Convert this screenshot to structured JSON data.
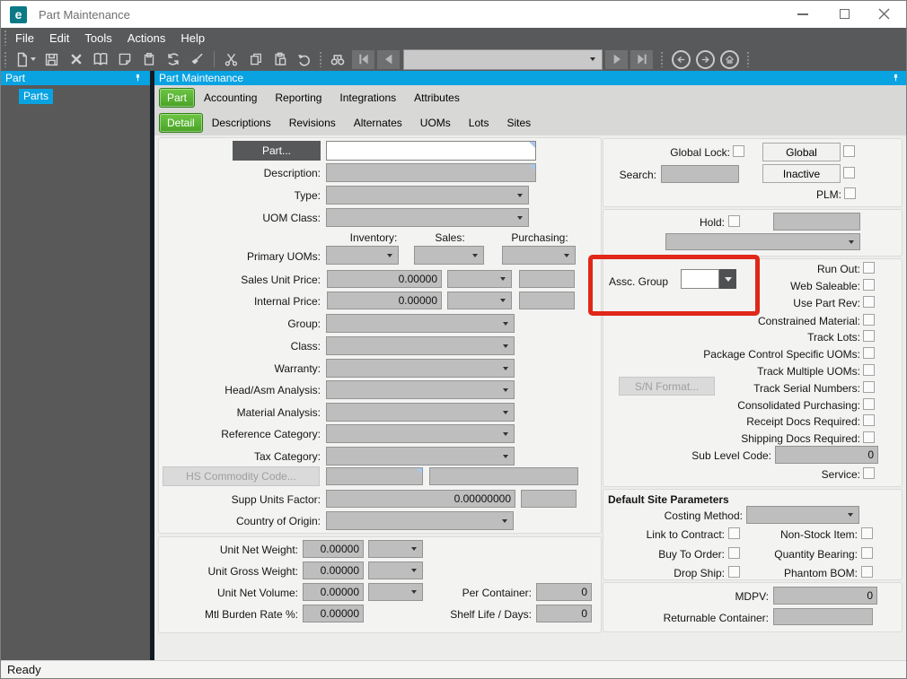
{
  "window": {
    "logo_text": "e",
    "title": "Part Maintenance",
    "status": "Ready"
  },
  "menu": {
    "items": [
      "File",
      "Edit",
      "Tools",
      "Actions",
      "Help"
    ]
  },
  "toolbar": {
    "icons": [
      "new-record",
      "save",
      "delete",
      "search-book",
      "memo",
      "attachment",
      "refresh",
      "clear",
      "cut",
      "copy",
      "paste",
      "undo",
      "find-binoculars",
      "first-record",
      "previous-record",
      "record-selector",
      "next-record",
      "last-record",
      "navigate-back",
      "navigate-forward",
      "home"
    ],
    "record_selector_value": ""
  },
  "sidebar": {
    "header": "Part",
    "items": [
      {
        "label": "Parts",
        "selected": true
      }
    ]
  },
  "main": {
    "header": "Part Maintenance",
    "tabs": [
      "Part",
      "Accounting",
      "Reporting",
      "Integrations",
      "Attributes"
    ],
    "active_tab": "Part",
    "subtabs": [
      "Detail",
      "Descriptions",
      "Revisions",
      "Alternates",
      "UOMs",
      "Lots",
      "Sites"
    ],
    "active_subtab": "Detail"
  },
  "form": {
    "left": {
      "part_button": "Part...",
      "description": "Description:",
      "type": "Type:",
      "uom_class": "UOM Class:",
      "uom_headers": [
        "Inventory:",
        "Sales:",
        "Purchasing:"
      ],
      "primary_uoms": "Primary UOMs:",
      "sales_unit_price": "Sales Unit Price:",
      "internal_price": "Internal Price:",
      "group": "Group:",
      "class": "Class:",
      "warranty": "Warranty:",
      "head_asm_analysis": "Head/Asm Analysis:",
      "material_analysis": "Material Analysis:",
      "reference_category": "Reference Category:",
      "tax_category": "Tax Category:",
      "hs_commodity_button": "HS Commodity Code...",
      "supp_units_factor": "Supp Units Factor:",
      "country_of_origin": "Country of Origin:",
      "unit_net_weight": "Unit Net Weight:",
      "unit_gross_weight": "Unit Gross Weight:",
      "unit_net_volume": "Unit Net Volume:",
      "mtl_burden_rate": "Mtl Burden Rate %:",
      "per_container": "Per Container:",
      "shelf_life": "Shelf Life / Days:"
    },
    "right": {
      "global_lock": "Global Lock:",
      "global_button": "Global",
      "search": "Search:",
      "inactive_button": "Inactive",
      "plm": "PLM:",
      "hold": "Hold:",
      "assc_group": "Assc. Group",
      "flags": [
        "Run Out:",
        "Web Saleable:",
        "Use Part Rev:",
        "Constrained Material:",
        "Track Lots:",
        "Package Control Specific UOMs:",
        "Track Multiple UOMs:",
        "Track Serial Numbers:",
        "Consolidated Purchasing:",
        "Receipt Docs Required:",
        "Shipping Docs Required:"
      ],
      "sn_format_button": "S/N Format...",
      "sub_level_code": "Sub Level Code:",
      "service": "Service:",
      "default_site_title": "Default Site Parameters",
      "costing_method": "Costing Method:",
      "link_to_contract": "Link to Contract:",
      "non_stock_item": "Non-Stock Item:",
      "buy_to_order": "Buy To Order:",
      "quantity_bearing": "Quantity Bearing:",
      "drop_ship": "Drop Ship:",
      "phantom_bom": "Phantom BOM:",
      "mdpv": "MDPV:",
      "returnable_container": "Returnable Container:"
    },
    "values": {
      "part": "",
      "description": "",
      "sales_unit_price": "0.00000",
      "internal_price": "0.00000",
      "supp_units_factor": "0.00000000",
      "unit_net_weight": "0.00000",
      "unit_gross_weight": "0.00000",
      "unit_net_volume": "0.00000",
      "mtl_burden_rate": "0.00000",
      "per_container": "0",
      "shelf_life": "0",
      "sub_level_code": "0",
      "mdpv": "0",
      "search": "",
      "hold": "",
      "returnable_container": ""
    }
  },
  "highlight": {
    "color": "#e02718",
    "target": "assc-group"
  }
}
